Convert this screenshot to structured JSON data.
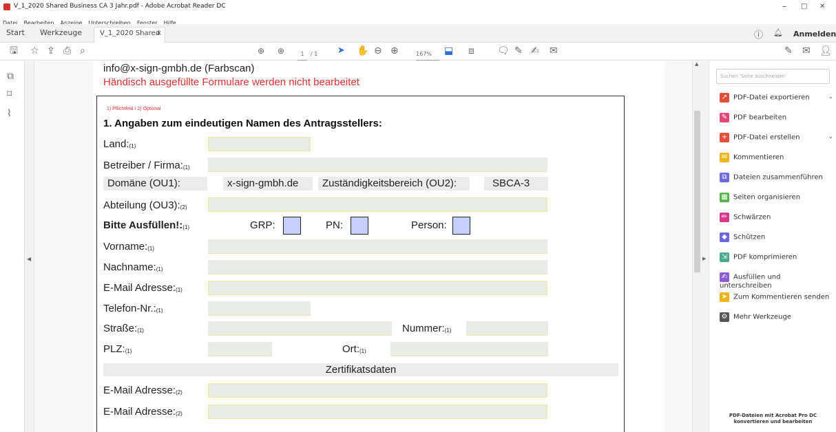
{
  "window": {
    "title": "V_1_2020 Shared Business CA 3 Jahr.pdf - Adobe Acrobat Reader DC",
    "minimize": "–",
    "maximize": "□",
    "close": "✕"
  },
  "menu": [
    "Datei",
    "Bearbeiten",
    "Anzeige",
    "Unterschreiben",
    "Fenster",
    "Hilfe"
  ],
  "tabs": {
    "start": "Start",
    "tools": "Werkzeuge",
    "doc": "V_1_2020 Shared B...",
    "doc_close": "×"
  },
  "account": {
    "signin": "Anmelden"
  },
  "toolbar": {
    "page": "1",
    "page_total": "/ 1",
    "zoom": "167%"
  },
  "document": {
    "email_note": "info@x-sign-gmbh.de (Farbscan)",
    "warning": "Händisch ausgefüllte Formulare werden nicht bearbeitet",
    "legend": "1) Pflichtfeld / 2) Optional",
    "heading": "1. Angaben zum eindeutigen Namen des Antragsstellers:",
    "labels": {
      "land": "Land:",
      "betreiber": "Betreiber / Firma:",
      "domaene": "Domäne (OU1):",
      "abteilung": "Abteilung (OU3):",
      "bitte": "Bitte Ausfüllen!:",
      "vorname": "Vorname:",
      "nachname": "Nachname:",
      "email": "E-Mail Adresse:",
      "telefon": "Telefon-Nr.:",
      "strasse": "Straße:",
      "plz": "PLZ:",
      "email2a": "E-Mail Adresse:",
      "email2b": "E-Mail Adresse:",
      "nummer": "Nummer:",
      "ort": "Ort:",
      "grp": "GRP:",
      "pn": "PN:",
      "person": "Person:",
      "zustaendigkeit": "Zuständigkeitsbereich (OU2):"
    },
    "marks": {
      "m1": "(1)",
      "m2": "(2)"
    },
    "values": {
      "domain": "x-sign-gmbh.de",
      "ou2": "SBCA-3"
    },
    "section": "Zertifikatsdaten"
  },
  "right_panel": {
    "search_placeholder": "Suchen 'Seite zuschneiden'",
    "tools": [
      {
        "label": "PDF-Datei exportieren",
        "color": "#e0503a",
        "icon": "export-pdf-icon",
        "chevron": true
      },
      {
        "label": "PDF bearbeiten",
        "color": "#e04878",
        "icon": "edit-pdf-icon",
        "chevron": false
      },
      {
        "label": "PDF-Datei erstellen",
        "color": "#e0503a",
        "icon": "create-pdf-icon",
        "chevron": true
      },
      {
        "label": "Kommentieren",
        "color": "#f1b51c",
        "icon": "comment-icon",
        "chevron": false
      },
      {
        "label": "Dateien zusammenführen",
        "color": "#6b68e0",
        "icon": "combine-files-icon",
        "chevron": false
      },
      {
        "label": "Seiten organisieren",
        "color": "#55b54a",
        "icon": "organize-pages-icon",
        "chevron": false
      },
      {
        "label": "Schwärzen",
        "color": "#d8388b",
        "icon": "redact-icon",
        "chevron": false
      },
      {
        "label": "Schützen",
        "color": "#6b68e0",
        "icon": "protect-icon",
        "chevron": false
      },
      {
        "label": "PDF komprimieren",
        "color": "#4aa98a",
        "icon": "compress-pdf-icon",
        "chevron": false
      },
      {
        "label": "Ausfüllen und unterschreiben",
        "color": "#8a5bd1",
        "icon": "fill-sign-icon",
        "chevron": false
      },
      {
        "label": "Zum Kommentieren senden",
        "color": "#f1b51c",
        "icon": "send-comment-icon",
        "chevron": false
      },
      {
        "label": "Mehr Werkzeuge",
        "color": "#555555",
        "icon": "more-tools-icon",
        "chevron": false
      }
    ],
    "footer_line1": "PDF-Dateien mit Acrobat Pro DC",
    "footer_line2": "konvertieren und bearbeiten"
  }
}
